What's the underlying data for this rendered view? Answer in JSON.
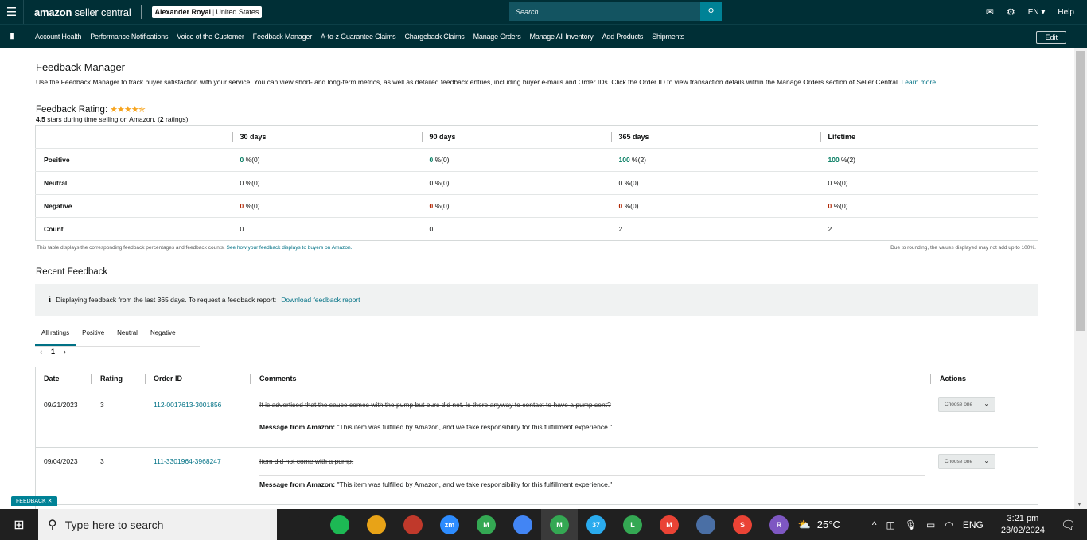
{
  "topbar": {
    "menu_icon": "menu-icon",
    "brand_bold": "amazon",
    "brand_rest": " seller central",
    "account_name": "Alexander Royal",
    "account_region": "United States",
    "search_placeholder": "Search",
    "language": "EN",
    "help": "Help"
  },
  "nav": {
    "items": [
      "Account Health",
      "Performance Notifications",
      "Voice of the Customer",
      "Feedback Manager",
      "A-to-z Guarantee Claims",
      "Chargeback Claims",
      "Manage Orders",
      "Manage All Inventory",
      "Add Products",
      "Shipments"
    ],
    "edit": "Edit"
  },
  "page": {
    "title": "Feedback Manager",
    "description": "Use the Feedback Manager to track buyer satisfaction with your service. You can view short- and long-term metrics, as well as detailed feedback entries, including buyer e-mails and Order IDs. Click the Order ID to view transaction details within the Manage Orders section of Seller Central.",
    "learn_more": "Learn more",
    "rating_label": "Feedback Rating:",
    "rating_value": 4.5,
    "stars_text": "★★★★✯",
    "rating_sub_value": "4.5",
    "rating_sub_mid": " stars during time selling on Amazon. (",
    "rating_sub_count": "2",
    "rating_sub_end": " ratings)"
  },
  "metrics": {
    "columns": [
      "30 days",
      "90 days",
      "365 days",
      "Lifetime"
    ],
    "rows": [
      {
        "label": "Positive",
        "cells": [
          {
            "v": "0",
            "s": " %(0)"
          },
          {
            "v": "0",
            "s": " %(0)"
          },
          {
            "v": "100",
            "s": " %(2)"
          },
          {
            "v": "100",
            "s": " %(2)"
          }
        ]
      },
      {
        "label": "Neutral",
        "cells": [
          {
            "v": "0",
            "s": " %(0)"
          },
          {
            "v": "0",
            "s": " %(0)"
          },
          {
            "v": "0",
            "s": " %(0)"
          },
          {
            "v": "0",
            "s": " %(0)"
          }
        ]
      },
      {
        "label": "Negative",
        "cells": [
          {
            "v": "0",
            "s": " %(0)"
          },
          {
            "v": "0",
            "s": " %(0)"
          },
          {
            "v": "0",
            "s": " %(0)"
          },
          {
            "v": "0",
            "s": " %(0)"
          }
        ]
      },
      {
        "label": "Count",
        "cells": [
          {
            "v": "0",
            "s": ""
          },
          {
            "v": "0",
            "s": ""
          },
          {
            "v": "2",
            "s": ""
          },
          {
            "v": "2",
            "s": ""
          }
        ]
      }
    ],
    "note_left": "This table displays the corresponding feedback percentages and feedback counts.",
    "note_left_link": "See how your feedback displays to buyers on Amazon.",
    "note_right": "Due to rounding, the values displayed may not add up to 100%."
  },
  "recent": {
    "title": "Recent Feedback",
    "info_text": "Displaying feedback from the last 365 days. To request a feedback report:",
    "info_link": "Download feedback report",
    "tabs": [
      "All ratings",
      "Positive",
      "Neutral",
      "Negative"
    ],
    "page_number": "1",
    "headers": {
      "date": "Date",
      "rating": "Rating",
      "order_id": "Order ID",
      "comments": "Comments",
      "actions": "Actions"
    },
    "rows": [
      {
        "date": "09/21/2023",
        "rating": "3",
        "order_id": "112-0017613-3001856",
        "comment": "It is advertised that the sauce comes with the pump but ours did not. Is there anyway to contact to have a pump sent?",
        "message_label": "Message from Amazon:",
        "message": " \"This item was fulfilled by Amazon, and we take responsibility for this fulfillment experience.\"",
        "action": "Choose one"
      },
      {
        "date": "09/04/2023",
        "rating": "3",
        "order_id": "111-3301964-3968247",
        "comment": "Item did not come with a pump.",
        "message_label": "Message from Amazon:",
        "message": " \"This item was fulfilled by Amazon, and we take responsibility for this fulfillment experience.\"",
        "action": "Choose one"
      }
    ],
    "feedback_tab": "FEEDBACK ✕"
  },
  "taskbar": {
    "search_placeholder": "Type here to search",
    "weather": "25°C",
    "lang": "ENG",
    "time": "3:21 pm",
    "date": "23/02/2024",
    "apps": [
      {
        "name": "task-view-icon",
        "color": "#202020",
        "label": ""
      },
      {
        "name": "spotify-icon",
        "color": "#1db954",
        "label": ""
      },
      {
        "name": "app-emoji-icon",
        "color": "#e8a317",
        "label": ""
      },
      {
        "name": "app-paint-icon",
        "color": "#c0392b",
        "label": ""
      },
      {
        "name": "zoom-icon",
        "color": "#2d8cff",
        "label": "zm"
      },
      {
        "name": "chrome-m-icon",
        "color": "#34a853",
        "label": "M"
      },
      {
        "name": "chrome-profile-icon",
        "color": "#4285f4",
        "label": ""
      },
      {
        "name": "chrome-m2-icon",
        "color": "#34a853",
        "label": "M"
      },
      {
        "name": "telegram-icon",
        "color": "#2aabee",
        "label": "37"
      },
      {
        "name": "chrome-l-icon",
        "color": "#34a853",
        "label": "L"
      },
      {
        "name": "chrome-m3-icon",
        "color": "#ea4335",
        "label": "M"
      },
      {
        "name": "calculator-icon",
        "color": "#4a6fa5",
        "label": ""
      },
      {
        "name": "chrome-s-icon",
        "color": "#ea4335",
        "label": "S"
      },
      {
        "name": "chrome-r-icon",
        "color": "#7e57c2",
        "label": "R"
      }
    ]
  }
}
